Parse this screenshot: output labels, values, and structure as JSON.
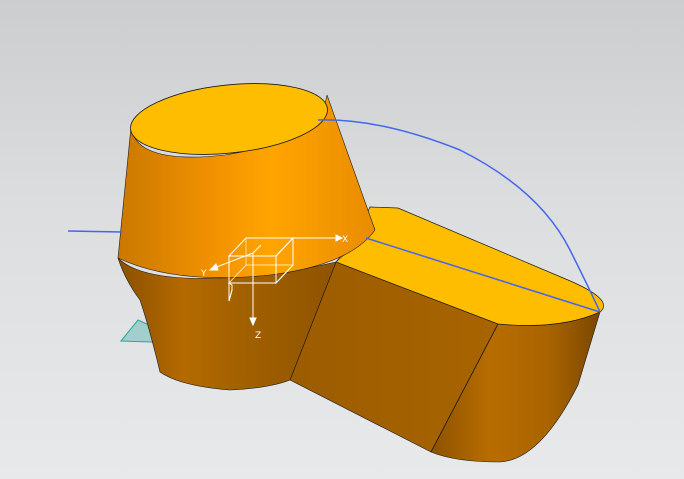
{
  "viewport": {
    "background_top": "#cbcdcf",
    "background_bottom": "#e8e9eb"
  },
  "model": {
    "body_color": "#ffbd00",
    "side_color": "#a66100",
    "curve_color": "#4466ee",
    "datum_plane_color": "#2aa8a0"
  },
  "triad": {
    "x_label": "X",
    "y_label": "Y",
    "z_label": "Z"
  }
}
